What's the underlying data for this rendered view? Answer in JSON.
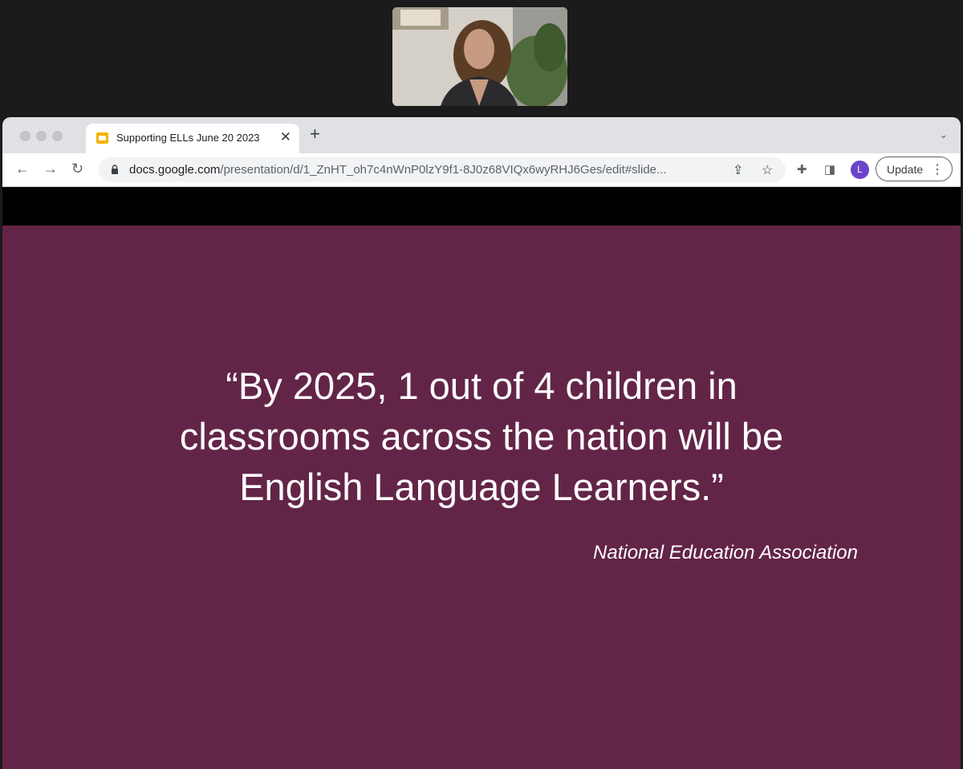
{
  "browser": {
    "tab": {
      "title": "Supporting ELLs June 20 2023",
      "favicon": "google-slides-icon"
    },
    "url": {
      "host": "docs.google.com",
      "path": "/presentation/d/1_ZnHT_oh7c4nWnP0lzY9f1-8J0z68VIQx6wyRHJ6Ges/edit#slide..."
    },
    "profile_initial": "L",
    "update_label": "Update"
  },
  "slide": {
    "quote_lines": [
      "“By 2025, 1 out of 4 children in",
      "classrooms across the nation will be",
      "English Language Learners.”"
    ],
    "attribution": "National Education Association",
    "background_color": "#632547"
  },
  "colors": {
    "profile": "#6b45c9",
    "slides_favicon": "#f4b400"
  }
}
